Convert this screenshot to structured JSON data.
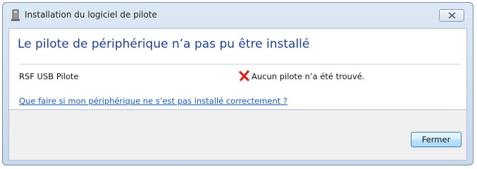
{
  "window": {
    "title": "Installation du logiciel de pilote",
    "title_icon": "driver-install-icon",
    "close_icon": "close-icon"
  },
  "main": {
    "heading": "Le pilote de périphérique n’a pas pu être installé",
    "device": {
      "name": "RSF USB Pilote",
      "status_icon": "error-x-icon",
      "status_text": "Aucun pilote n’a été trouvé."
    },
    "help_link": "Que faire si mon périphérique ne s’est pas installé correctement ?"
  },
  "footer": {
    "close_label": "Fermer"
  },
  "colors": {
    "heading": "#1f3f8f",
    "link": "#1a5bb8",
    "error": "#d8221e",
    "titlebar": "#dde8f4",
    "footer_bg": "#f0f0f0"
  }
}
